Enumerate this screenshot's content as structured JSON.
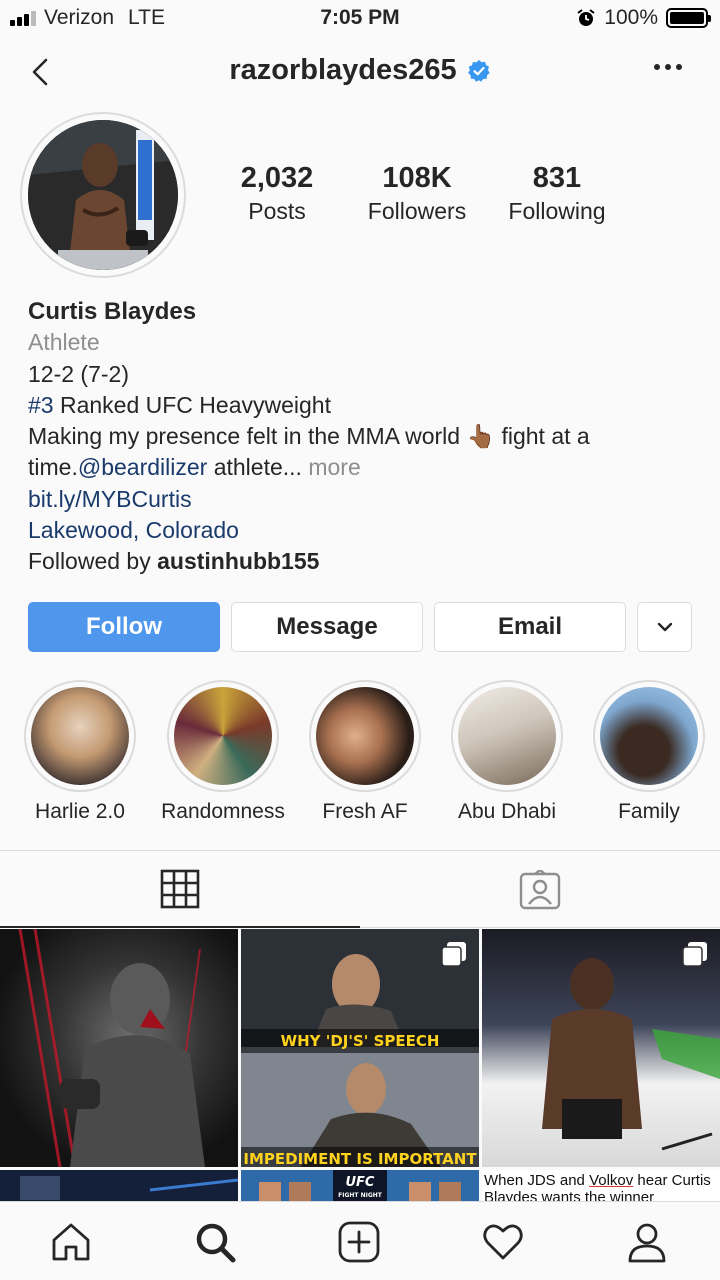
{
  "status_bar": {
    "carrier": "Verizon",
    "network": "LTE",
    "time": "7:05 PM",
    "battery": "100%",
    "signal_bars_filled": 3,
    "signal_bars_total": 4,
    "battery_level": 1.0
  },
  "header": {
    "username": "razorblaydes265",
    "verified": true
  },
  "stats": {
    "posts_count": "2,032",
    "posts_label": "Posts",
    "followers_count": "108K",
    "followers_label": "Followers",
    "following_count": "831",
    "following_label": "Following"
  },
  "bio": {
    "name": "Curtis Blaydes",
    "category": "Athlete",
    "line1": "12-2 (7-2)",
    "hashtag": "#3",
    "line2_rest": " Ranked UFC Heavyweight",
    "line3": "Making my presence felt in the MMA world 👆🏾 fight at a time.",
    "mention": "@beardilizer",
    "line3_rest": " athlete...",
    "more": "more",
    "website": "bit.ly/MYBCurtis",
    "location": "Lakewood, Colorado",
    "followed_by_prefix": "Followed by ",
    "followed_by_user": "austinhubb155"
  },
  "actions": {
    "follow": "Follow",
    "message": "Message",
    "email": "Email"
  },
  "highlights": [
    {
      "label": "Harlie 2.0",
      "color_a": "#d9c6b0",
      "color_b": "#7b4a2a"
    },
    {
      "label": "Randomness",
      "color_a": "#c9a43a",
      "color_b": "#7a3a2a"
    },
    {
      "label": "Fresh AF",
      "color_a": "#d8a57a",
      "color_b": "#3a2a20"
    },
    {
      "label": "Abu Dhabi",
      "color_a": "#e8e4de",
      "color_b": "#8a7a6a"
    },
    {
      "label": "Family",
      "color_a": "#9cc0e0",
      "color_b": "#3a2a22"
    }
  ],
  "tabs": {
    "grid_icon": "grid-icon",
    "tagged_icon": "tagged-person-icon"
  },
  "posts": {
    "post2_caption_top": "WHY 'DJ'S' SPEECH",
    "post2_caption_bottom": "IMPEDIMENT IS IMPORTANT",
    "post5_logo_line1": "UFC",
    "post5_logo_line2": "FIGHT NIGHT",
    "post6_text_a": "When JDS and ",
    "post6_text_u": "Volkov",
    "post6_text_b": " hear Curtis Blaydes wants the winner"
  },
  "bottom_nav": [
    "home-icon",
    "search-icon",
    "add-post-icon",
    "heart-icon",
    "profile-icon"
  ],
  "colors": {
    "follow_button": "#4f96ed",
    "link": "#1a3a6b",
    "verified_badge": "#3897f0",
    "caption_yellow": "#ffd21e"
  }
}
